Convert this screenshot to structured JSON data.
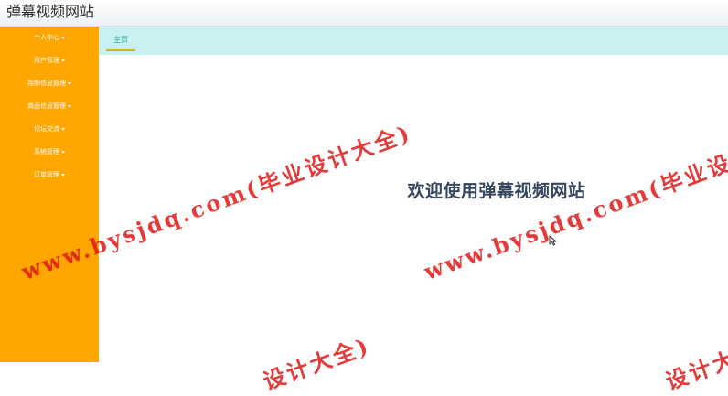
{
  "header": {
    "app_title": "弹幕视频网站"
  },
  "sidebar": {
    "items": [
      {
        "label": "个人中心"
      },
      {
        "label": "用户管理"
      },
      {
        "label": "视频信息管理"
      },
      {
        "label": "商品信息管理"
      },
      {
        "label": "论坛交流"
      },
      {
        "label": "系统管理"
      },
      {
        "label": "订单管理"
      }
    ]
  },
  "tabs": [
    {
      "label": "主页"
    }
  ],
  "main": {
    "welcome_text": "欢迎使用弹幕视频网站"
  },
  "watermark": {
    "text_full": "www.bysjdq.com(毕业设计大全)",
    "text_tail": "设计大全)",
    "color": "#e21818"
  }
}
